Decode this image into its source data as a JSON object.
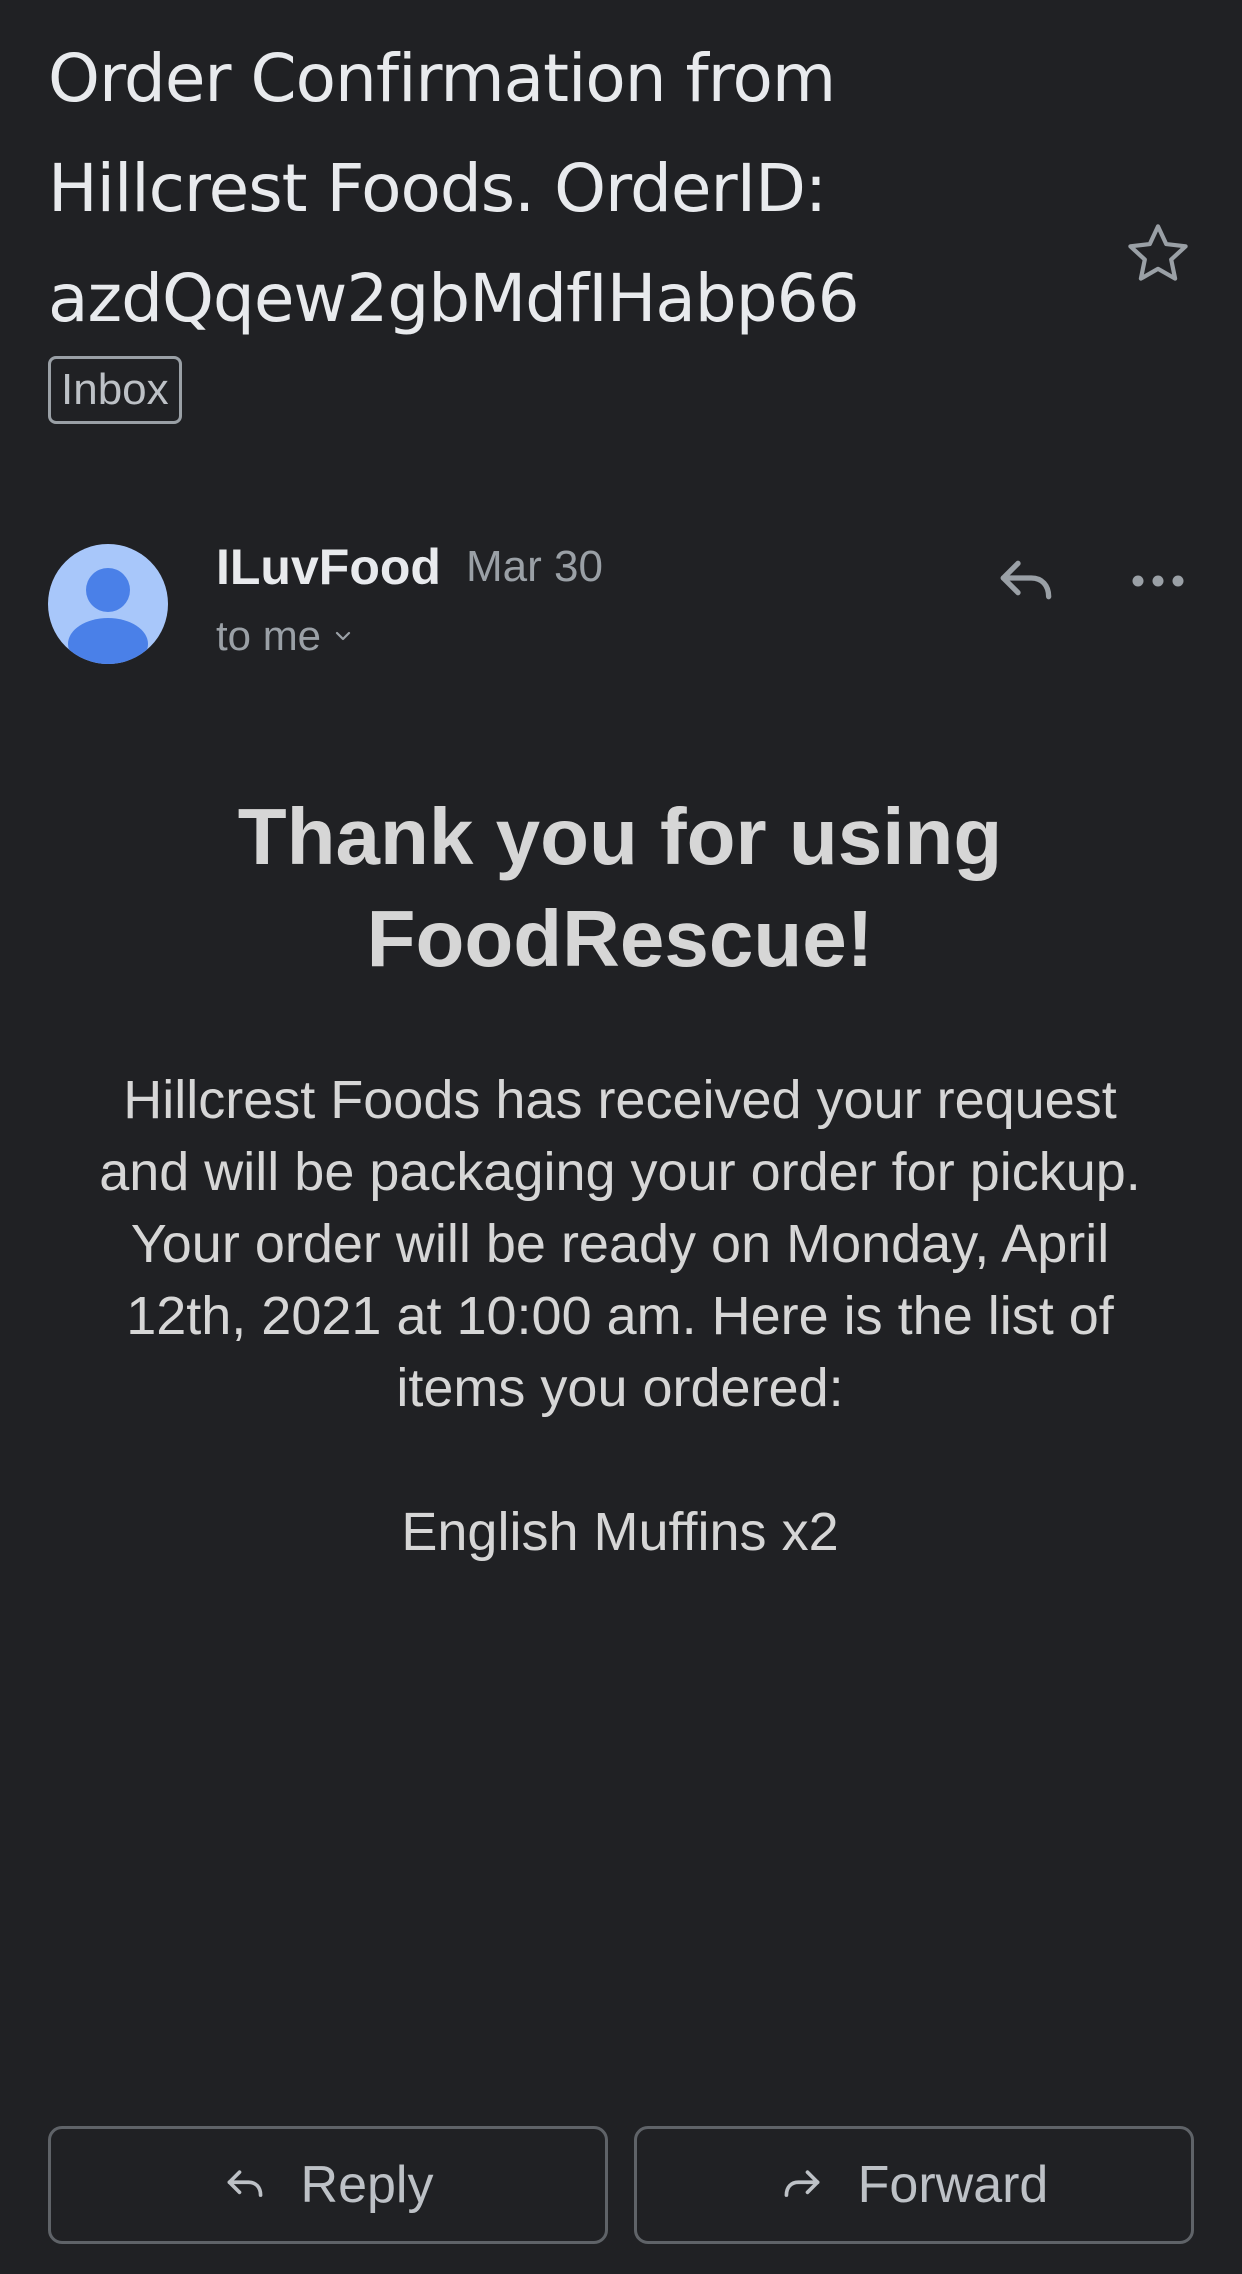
{
  "email": {
    "subject_lines": [
      "Order Confirmation from",
      "Hillcrest Foods. OrderID:",
      "azdQqew2gbMdfIHabp66"
    ],
    "label": "Inbox",
    "sender": {
      "name": "ILuvFood",
      "date": "Mar 30",
      "recipient": "to me"
    },
    "body": {
      "heading_lines": [
        "Thank you for using",
        "FoodRescue!"
      ],
      "paragraph_lines": [
        "Hillcrest Foods has received your request",
        "and will be packaging your order for pickup.",
        "Your order will be ready on Monday, April",
        "12th, 2021 at 10:00 am. Here is the list of",
        "items you ordered:"
      ],
      "items": [
        "English Muffins x2"
      ]
    }
  },
  "actions": {
    "reply_label": "Reply",
    "forward_label": "Forward"
  },
  "icons": {
    "star": "star-outline-icon",
    "avatar": "person-icon",
    "reply": "reply-arrow-icon",
    "more": "more-horizontal-icon",
    "expand": "chevron-down-icon",
    "forward": "forward-arrow-icon"
  },
  "colors": {
    "background": "#202124",
    "text": "#e8eaed",
    "secondary_text": "#9aa0a6",
    "avatar_bg": "#a8c7fa",
    "avatar_fg": "#4a80e8"
  }
}
